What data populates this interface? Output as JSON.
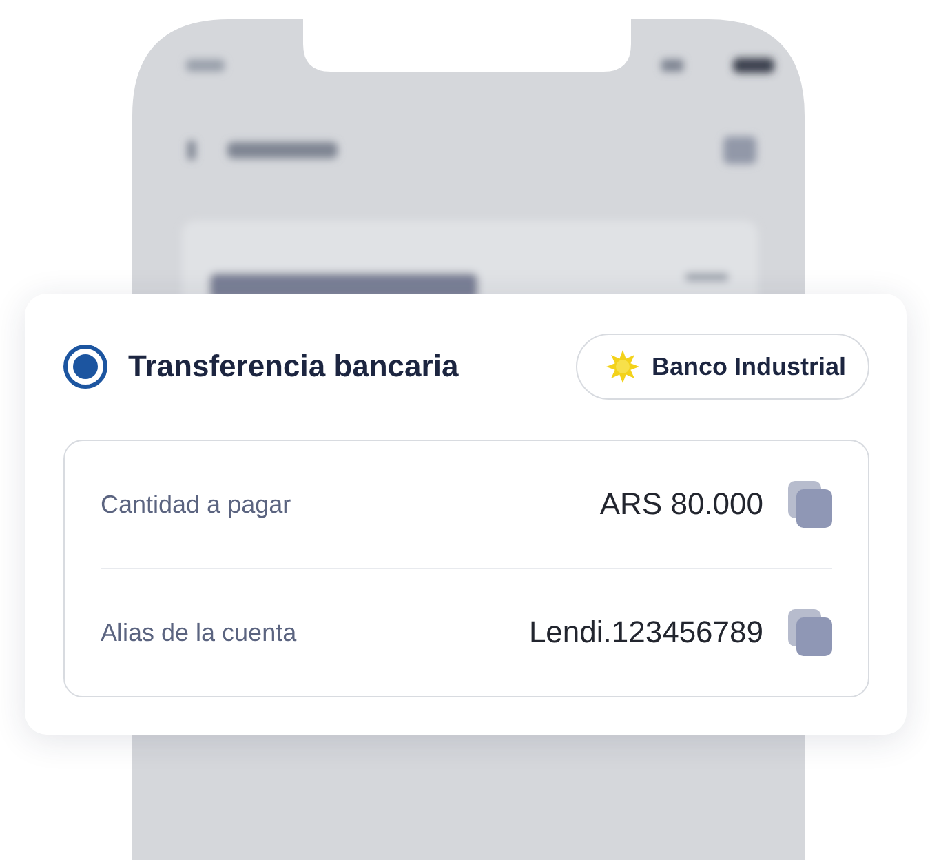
{
  "payment_option": {
    "label": "Transferencia bancaria",
    "selected": true,
    "bank": "Banco Industrial"
  },
  "details": [
    {
      "label": "Cantidad a pagar",
      "value": "ARS 80.000"
    },
    {
      "label": "Alias de la cuenta",
      "value": "Lendi.123456789"
    }
  ]
}
